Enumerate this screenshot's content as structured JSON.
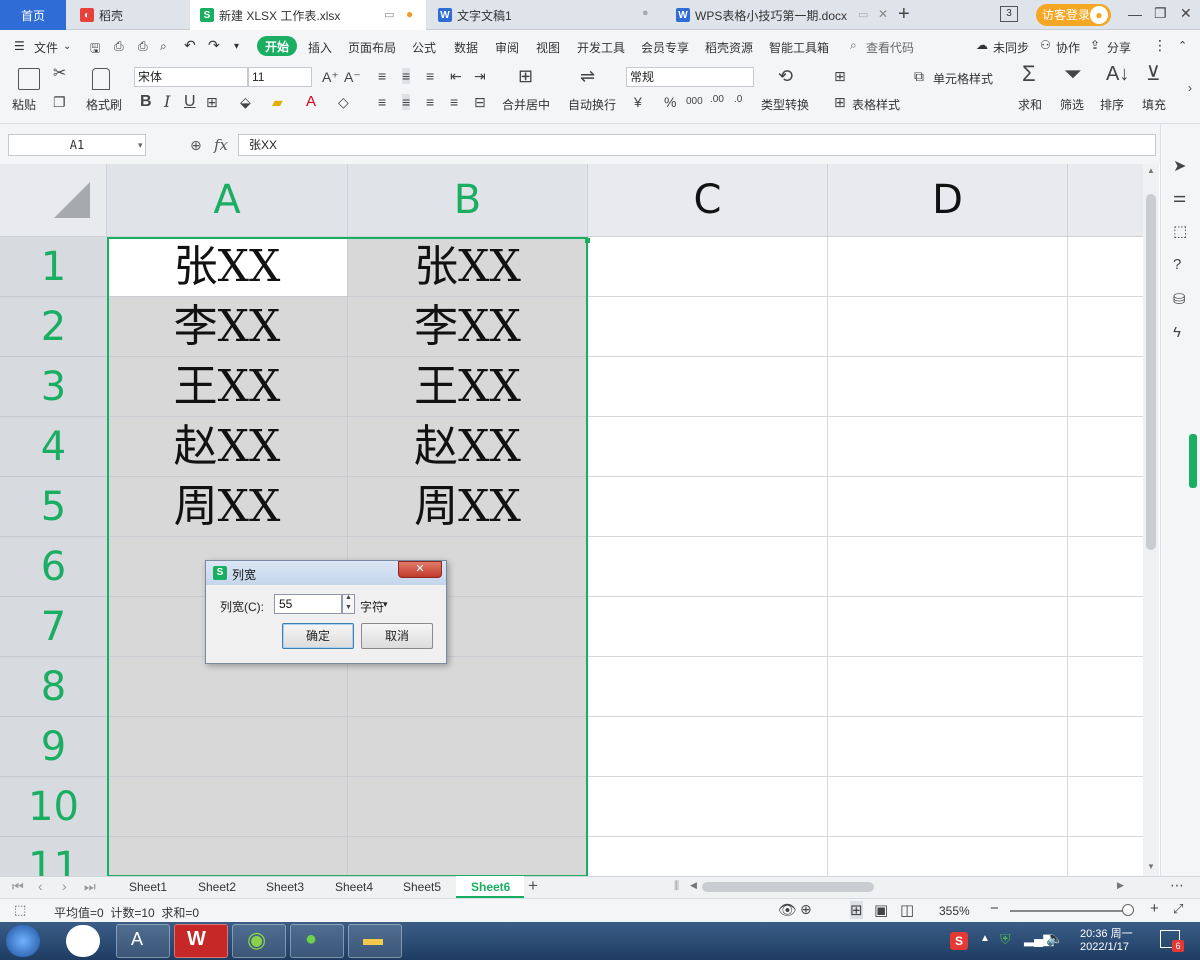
{
  "tabs": {
    "home": "首页",
    "daoke": "稻壳",
    "workbook": "新建 XLSX 工作表.xlsx",
    "doc1": "文字文稿1",
    "doc2": "WPS表格小技巧第一期.docx",
    "window_count": "3",
    "login": "访客登录"
  },
  "menu": {
    "file": "文件",
    "items": [
      "开始",
      "插入",
      "页面布局",
      "公式",
      "数据",
      "审阅",
      "视图",
      "开发工具",
      "会员专享",
      "稻壳资源",
      "智能工具箱"
    ],
    "search": "查看代码",
    "unsynced": "未同步",
    "collab": "协作",
    "share": "分享"
  },
  "ribbon": {
    "paste": "粘贴",
    "format_painter": "格式刷",
    "font_name": "宋体",
    "font_size": "11",
    "merge_center": "合并居中",
    "wrap_text": "自动换行",
    "number_format": "常规",
    "convert_type": "类型转换",
    "cell_style": "单元格样式",
    "table_style": "表格样式",
    "sum": "求和",
    "filter": "筛选",
    "sort": "排序",
    "fill": "填充"
  },
  "formula_bar": {
    "name_box": "A1",
    "fx": "fx",
    "content": "张XX"
  },
  "sheet": {
    "columns": [
      "A",
      "B",
      "C",
      "D"
    ],
    "rows": [
      "1",
      "2",
      "3",
      "4",
      "5",
      "6",
      "7",
      "8",
      "9",
      "10",
      "11"
    ],
    "col_a": [
      "张XX",
      "李XX",
      "王XX",
      "赵XX",
      "周XX"
    ],
    "col_b": [
      "张XX",
      "李XX",
      "王XX",
      "赵XX",
      "周XX"
    ]
  },
  "sheet_tabs": [
    "Sheet1",
    "Sheet2",
    "Sheet3",
    "Sheet4",
    "Sheet5",
    "Sheet6"
  ],
  "active_sheet": "Sheet6",
  "status": {
    "summary": "平均值=0  计数=10  求和=0",
    "zoom": "355%"
  },
  "dialog": {
    "title": "列宽",
    "label": "列宽(C):",
    "value": "55",
    "unit": "字符",
    "ok": "确定",
    "cancel": "取消"
  },
  "taskbar": {
    "time": "20:36 周一",
    "date": "2022/1/17",
    "badge": "6"
  },
  "colors": {
    "accent_green": "#1aae63",
    "home_blue": "#2f6cd6",
    "login_orange": "#f5a623"
  }
}
